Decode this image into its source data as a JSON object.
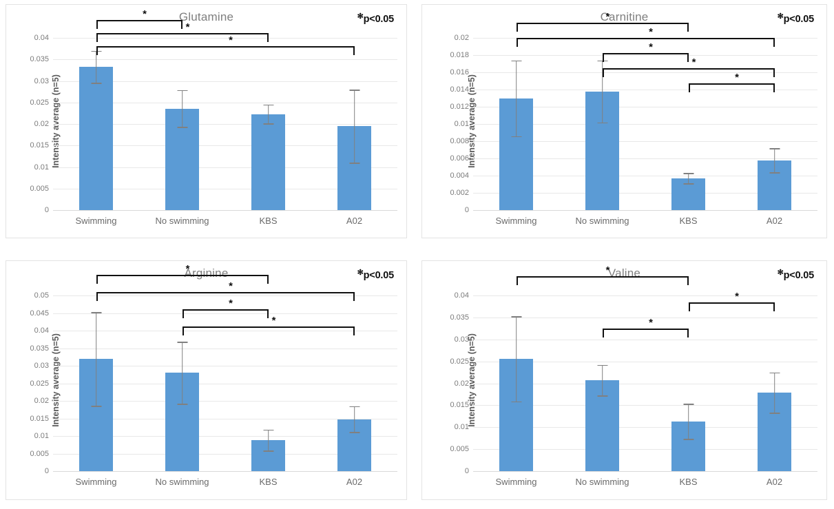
{
  "figure": {
    "significance_note": "p<0.05",
    "significance_marker": "*",
    "categories": [
      "Swimming",
      "No swimming",
      "KBS",
      "A02"
    ],
    "yaxis_title": "Intensity average (n=5)",
    "bar_color": "#5B9BD5",
    "error_bar_color": "#808080",
    "bracket_color": "#101010",
    "title_color": "#7F7F7F"
  },
  "chart_data": [
    {
      "type": "bar",
      "panel": "top-left",
      "title": "Glutamine",
      "xlabel": "",
      "ylabel": "Intensity average (n=5)",
      "categories": [
        "Swimming",
        "No swimming",
        "KBS",
        "A02"
      ],
      "values": [
        0.0333,
        0.0236,
        0.0223,
        0.0195
      ],
      "errors": [
        0.0037,
        0.0043,
        0.0022,
        0.0085
      ],
      "ylim": [
        0,
        0.04
      ],
      "ytick_step": 0.005,
      "ytick_labels": [
        "0",
        "0.005",
        "0.01",
        "0.015",
        "0.02",
        "0.025",
        "0.03",
        "0.035",
        "0.04"
      ],
      "grid": true,
      "legend": "none",
      "annotation": "*p<0.05",
      "significance": [
        {
          "from": "Swimming",
          "to": "No swimming",
          "marker": "*",
          "level": 1
        },
        {
          "from": "Swimming",
          "to": "KBS",
          "marker": "*",
          "level": 2
        },
        {
          "from": "Swimming",
          "to": "A02",
          "marker": "*",
          "level": 3
        }
      ]
    },
    {
      "type": "bar",
      "panel": "top-right",
      "title": "Carnitine",
      "xlabel": "",
      "ylabel": "Intensity average (n=5)",
      "categories": [
        "Swimming",
        "No swimming",
        "KBS",
        "A02"
      ],
      "values": [
        0.013,
        0.0138,
        0.0037,
        0.0058
      ],
      "errors": [
        0.0044,
        0.0036,
        0.0006,
        0.0014
      ],
      "ylim": [
        0,
        0.02
      ],
      "ytick_step": 0.002,
      "ytick_labels": [
        "0",
        "0.002",
        "0.004",
        "0.006",
        "0.008",
        "0.01",
        "0.012",
        "0.014",
        "0.016",
        "0.018",
        "0.02"
      ],
      "grid": true,
      "legend": "none",
      "annotation": "*p<0.05",
      "significance": [
        {
          "from": "Swimming",
          "to": "KBS",
          "marker": "*",
          "level": 1
        },
        {
          "from": "Swimming",
          "to": "A02",
          "marker": "*",
          "level": 2
        },
        {
          "from": "No swimming",
          "to": "KBS",
          "marker": "*",
          "level": 3
        },
        {
          "from": "No swimming",
          "to": "A02",
          "marker": "*",
          "level": 4
        },
        {
          "from": "KBS",
          "to": "A02",
          "marker": "*",
          "level": 5
        }
      ]
    },
    {
      "type": "bar",
      "panel": "bottom-left",
      "title": "Arginine",
      "xlabel": "",
      "ylabel": "Intensity average (n=5)",
      "categories": [
        "Swimming",
        "No swimming",
        "KBS",
        "A02"
      ],
      "values": [
        0.0319,
        0.028,
        0.0088,
        0.0148
      ],
      "errors": [
        0.0133,
        0.0088,
        0.003,
        0.0037
      ],
      "ylim": [
        0,
        0.05
      ],
      "ytick_step": 0.005,
      "ytick_labels": [
        "0",
        "0.005",
        "0.01",
        "0.015",
        "0.02",
        "0.025",
        "0.03",
        "0.035",
        "0.04",
        "0.045",
        "0.05"
      ],
      "grid": true,
      "legend": "none",
      "annotation": "*p<0.05",
      "significance": [
        {
          "from": "Swimming",
          "to": "KBS",
          "marker": "*",
          "level": 1
        },
        {
          "from": "Swimming",
          "to": "A02",
          "marker": "*",
          "level": 2
        },
        {
          "from": "No swimming",
          "to": "KBS",
          "marker": "*",
          "level": 3
        },
        {
          "from": "No swimming",
          "to": "A02",
          "marker": "*",
          "level": 4
        }
      ]
    },
    {
      "type": "bar",
      "panel": "bottom-right",
      "title": "Valine",
      "xlabel": "",
      "ylabel": "Intensity average (n=5)",
      "categories": [
        "Swimming",
        "No swimming",
        "KBS",
        "A02"
      ],
      "values": [
        0.0256,
        0.0207,
        0.0113,
        0.0179
      ],
      "errors": [
        0.0097,
        0.0035,
        0.004,
        0.0046
      ],
      "ylim": [
        0,
        0.04
      ],
      "ytick_step": 0.005,
      "ytick_labels": [
        "0",
        "0.005",
        "0.01",
        "0.015",
        "0.02",
        "0.025",
        "0.03",
        "0.035",
        "0.04"
      ],
      "grid": true,
      "legend": "none",
      "annotation": "*p<0.05",
      "significance": [
        {
          "from": "Swimming",
          "to": "KBS",
          "marker": "*",
          "level": 1
        },
        {
          "from": "KBS",
          "to": "A02",
          "marker": "*",
          "level": 2
        },
        {
          "from": "No swimming",
          "to": "KBS",
          "marker": "*",
          "level": 3
        }
      ]
    }
  ]
}
